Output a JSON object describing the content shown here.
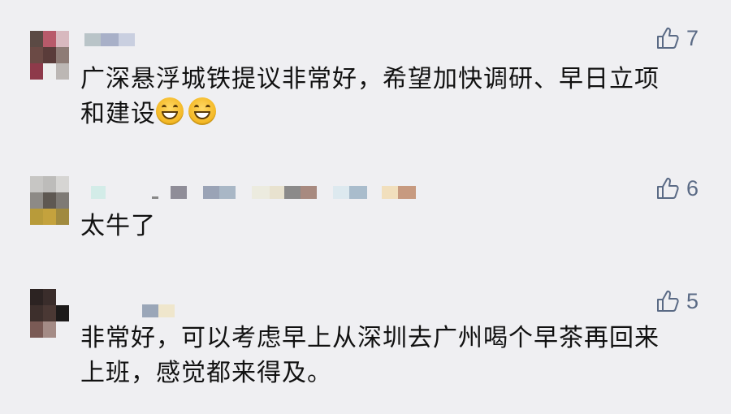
{
  "colors": {
    "background": "#efeff2",
    "text": "#111111",
    "like": "#5a6a85"
  },
  "comments": [
    {
      "text": "广深悬浮城铁提议非常好，希望加快调研、早日立项\n和建设",
      "emojis": [
        "grinning-face-icon",
        "grinning-face-icon"
      ],
      "likes": "7"
    },
    {
      "text": "太牛了",
      "emojis": [],
      "likes": "6"
    },
    {
      "text": "非常好，可以考虑早上从深圳去广州喝个早茶再回来\n上班，感觉都来得及。",
      "emojis": [],
      "likes": "5"
    }
  ]
}
